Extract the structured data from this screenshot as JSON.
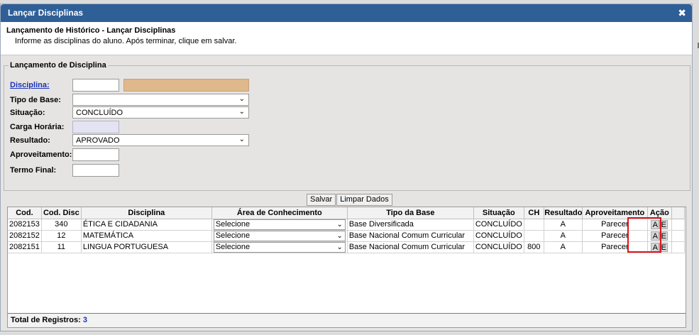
{
  "dialog": {
    "title": "Lançar Disciplinas",
    "close_glyph": "✖"
  },
  "header": {
    "title": "Lançamento de Histórico - Lançar Disciplinas",
    "instruction": "Informe as disciplinas do aluno. Após terminar, clique em salvar."
  },
  "form": {
    "legend": "Lançamento de Disciplina",
    "disciplina_label": "Disciplina:",
    "disciplina_code": "",
    "disciplina_name": "",
    "tipo_base_label": "Tipo de Base:",
    "tipo_base_value": "",
    "situacao_label": "Situação:",
    "situacao_value": "CONCLUÍDO",
    "carga_label": "Carga Horária:",
    "carga_value": "",
    "resultado_label": "Resultado:",
    "resultado_value": "APROVADO",
    "aproveitamento_label": "Aproveitamento:",
    "aproveitamento_value": "",
    "termo_label": "Termo Final:",
    "termo_value": ""
  },
  "buttons": {
    "save": "Salvar",
    "clear": "Limpar Dados"
  },
  "grid": {
    "columns": [
      "Cod.",
      "Cod. Disc",
      "Disciplina",
      "Área de Conhecimento",
      "Tipo da Base",
      "Situação",
      "CH",
      "Resultado",
      "Aproveitamento",
      "Ação"
    ],
    "rows": [
      {
        "cod": "2082153",
        "cod_disc": "340",
        "disciplina": "ÉTICA E CIDADANIA",
        "area": "Selecione",
        "tipo_base": "Base Diversificada",
        "situacao": "CONCLUÍDO",
        "ch": "",
        "resultado": "A",
        "aproveitamento": "Parecer",
        "edit": "A",
        "delete": "E"
      },
      {
        "cod": "2082152",
        "cod_disc": "12",
        "disciplina": "MATEMÁTICA",
        "area": "Selecione",
        "tipo_base": "Base Nacional Comum Curricular",
        "situacao": "CONCLUÍDO",
        "ch": "",
        "resultado": "A",
        "aproveitamento": "Parecer",
        "edit": "A",
        "delete": "E"
      },
      {
        "cod": "2082151",
        "cod_disc": "11",
        "disciplina": "LINGUA PORTUGUESA",
        "area": "Selecione",
        "tipo_base": "Base Nacional Comum Curricular",
        "situacao": "CONCLUÍDO",
        "ch": "800",
        "resultado": "A",
        "aproveitamento": "Parecer",
        "edit": "A",
        "delete": "E"
      }
    ],
    "total_label": "Total de Registros:",
    "total_value": "3"
  },
  "colors": {
    "titlebar": "#2f5f97",
    "highlight": "#e0141c",
    "link": "#1a33b8"
  }
}
